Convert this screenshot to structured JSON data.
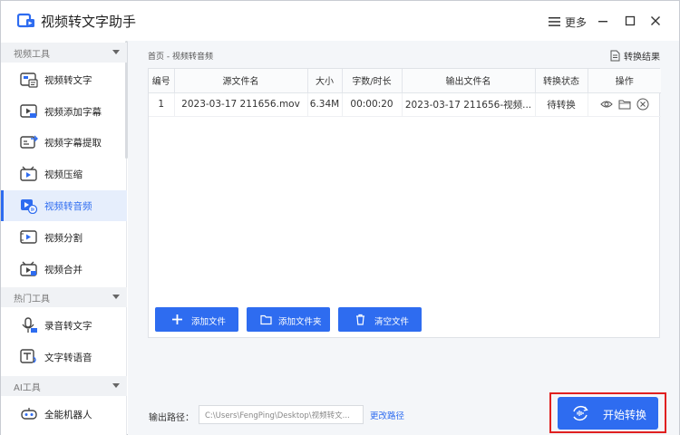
{
  "app": {
    "title": "视频转文字助手",
    "more_label": "更多"
  },
  "sidebar": {
    "sections": [
      {
        "label": "视频工具"
      },
      {
        "label": "热门工具"
      },
      {
        "label": "AI工具"
      }
    ],
    "items": [
      {
        "label": "视频转文字"
      },
      {
        "label": "视频添加字幕"
      },
      {
        "label": "视频字幕提取"
      },
      {
        "label": "视频压缩"
      },
      {
        "label": "视频转音频"
      },
      {
        "label": "视频分割"
      },
      {
        "label": "视频合并"
      },
      {
        "label": "录音转文字"
      },
      {
        "label": "文字转语音"
      },
      {
        "label": "全能机器人"
      }
    ],
    "active_index": 4
  },
  "main": {
    "breadcrumb": "首页 - 视频转音频",
    "result_link": "转换结果",
    "table": {
      "headers": [
        "编号",
        "源文件名",
        "大小",
        "字数/时长",
        "输出文件名",
        "转换状态",
        "操作"
      ],
      "rows": [
        [
          "1",
          "2023-03-17 211656.mov",
          "6.34M",
          "00:00:20",
          "2023-03-17 211656-视频...",
          "待转换"
        ]
      ]
    },
    "buttons": {
      "add_file": "添加文件",
      "add_folder": "添加文件夹",
      "clear_files": "清空文件"
    },
    "output": {
      "label": "输出路径：",
      "path": "C:\\Users\\FengPing\\Desktop\\视频转文...",
      "change_label": "更改路径"
    },
    "start_button": "开始转换"
  },
  "colors": {
    "accent": "#2e6cf0",
    "highlight": "#e02020"
  }
}
